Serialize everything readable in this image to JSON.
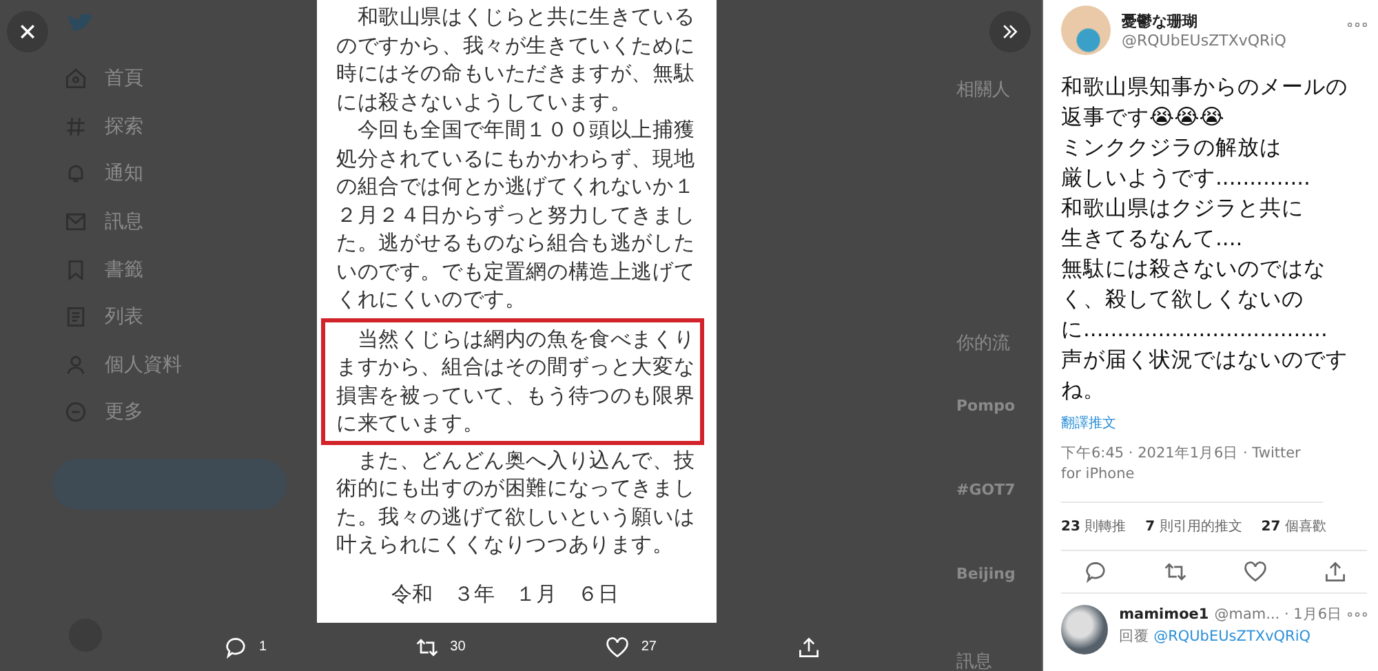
{
  "background": {
    "nav": [
      {
        "label": "首頁",
        "kind": "home"
      },
      {
        "label": "探索",
        "kind": "hash"
      },
      {
        "label": "通知",
        "kind": "bell"
      },
      {
        "label": "訊息",
        "kind": "mail"
      },
      {
        "label": "書籤",
        "kind": "bookmark"
      },
      {
        "label": "列表",
        "kind": "list"
      },
      {
        "label": "個人資料",
        "kind": "person"
      },
      {
        "label": "更多",
        "kind": "more"
      }
    ],
    "side_texts": [
      {
        "text": "相關人",
        "kind": "heading"
      },
      {
        "text": "你的流",
        "kind": "heading"
      },
      {
        "text": "Pompo",
        "kind": "trend"
      },
      {
        "text": "#GOT7",
        "kind": "trend"
      },
      {
        "text": "Beijing",
        "kind": "trend"
      },
      {
        "text": "訊息",
        "kind": "heading"
      }
    ]
  },
  "image": {
    "paragraphs": [
      {
        "highlighted": false,
        "lines": [
          "　和歌山県はくじらと共に生きている",
          "のですから、我々が生きていくために",
          "時にはその命もいただきますが、無駄",
          "には殺さないようしています。"
        ]
      },
      {
        "highlighted": false,
        "lines": [
          "　今回も全国で年間１００頭以上捕獲",
          "処分されているにもかかわらず、現地",
          "の組合では何とか逃げてくれないか１",
          "２月２４日からずっと努力してきまし",
          "た。逃がせるものなら組合も逃がした",
          "いのです。でも定置網の構造上逃げて",
          "くれにくいのです。"
        ]
      },
      {
        "highlighted": true,
        "lines": [
          "　当然くじらは網内の魚を食べまくり",
          "ますから、組合はその間ずっと大変な",
          "損害を被っていて、もう待つのも限界",
          "に来ています。"
        ]
      },
      {
        "highlighted": false,
        "lines": [
          "　また、どんどん奥へ入り込んで、技",
          "術的にも出すのが困難になってきまし",
          "た。我々の逃げて欲しいという願いは",
          "叶えられにくくなりつつあります。"
        ]
      }
    ],
    "date": "令和　３年　１月　６日"
  },
  "media_actions": [
    {
      "kind": "reply",
      "count": "1"
    },
    {
      "kind": "retweet",
      "count": "30"
    },
    {
      "kind": "like",
      "count": "27"
    },
    {
      "kind": "share"
    }
  ],
  "tweet": {
    "name": "憂鬱な珊瑚",
    "handle": "@RQUbEUsZTXvQRiQ",
    "lines": [
      "和歌山県知事からのメールの",
      "返事です😭😭😭",
      "ミンククジラの解放は",
      "厳しいようです..............",
      "和歌山県はクジラと共に",
      "生きてるなんて....",
      "無駄には殺さないのではな",
      "く、殺して欲しくないの",
      "に....................................",
      "声が届く状況ではないのです",
      "ね。"
    ],
    "translate": "翻譯推文",
    "timestamp": "下午6:45 · 2021年1月6日 · Twitter for iPhone",
    "stats": [
      {
        "count": "23",
        "label": "則轉推"
      },
      {
        "count": "7",
        "label": "則引用的推文"
      },
      {
        "count": "27",
        "label": "個喜歡"
      }
    ]
  },
  "reply": {
    "name": "mamimoe1",
    "meta": "@mam... · 1月6日",
    "reply_to_label": "回覆",
    "reply_to": "@RQUbEUsZTXvQRiQ"
  }
}
